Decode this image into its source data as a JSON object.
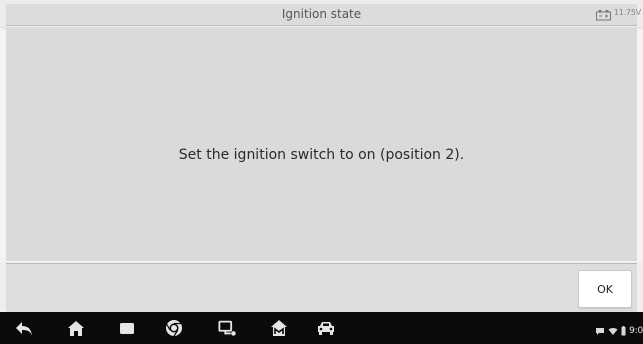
{
  "header": {
    "title": "Ignition state",
    "battery_voltage": "11.75V",
    "battery_icon": "battery-icon"
  },
  "main": {
    "message": "Set the ignition switch to on (position 2)."
  },
  "footer": {
    "ok_label": "OK"
  },
  "navbar": {
    "icons": [
      "back-icon",
      "home-icon",
      "recent-apps-icon",
      "chrome-icon",
      "vci-connection-icon",
      "maxifix-icon",
      "vehicle-icon"
    ],
    "status": {
      "icons": [
        "chat-icon",
        "wifi-icon",
        "battery-status-icon"
      ],
      "time": "9:0"
    }
  },
  "colors": {
    "background": "#f4f4f4",
    "content_panel": "#dadada",
    "navbar": "#0b0b0b",
    "text": "#2a2a2a"
  }
}
